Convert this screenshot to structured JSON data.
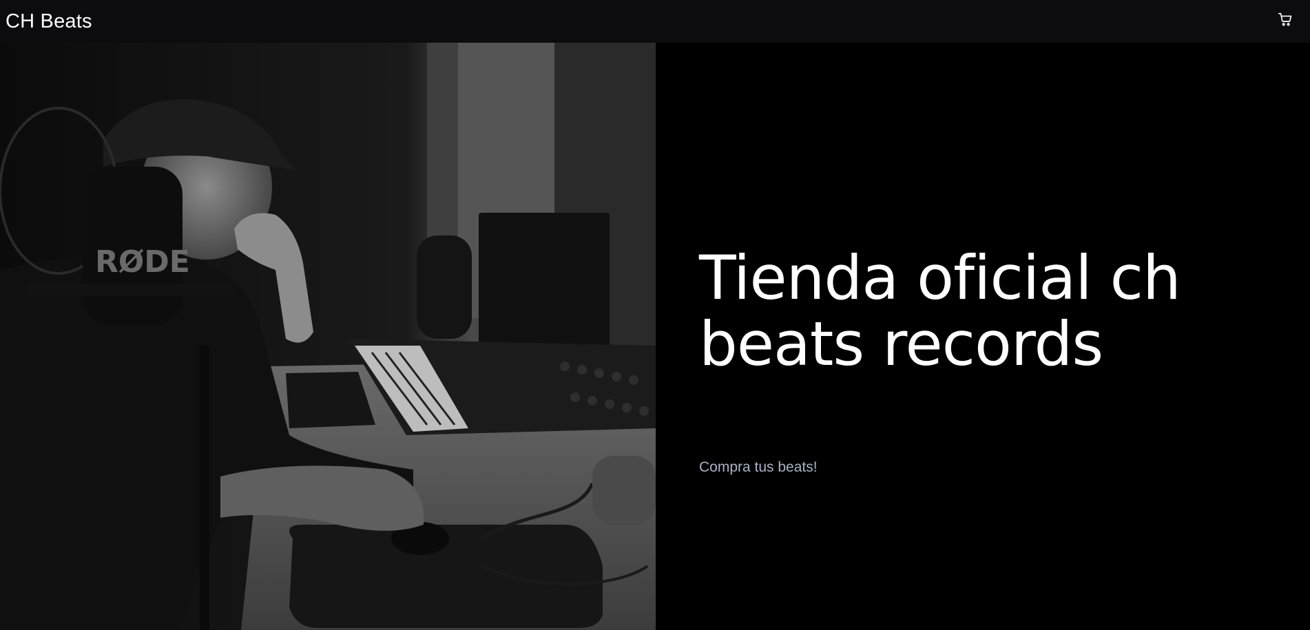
{
  "navbar": {
    "brand": "CH Beats",
    "cart_icon": "cart-icon"
  },
  "hero": {
    "image_alt": "producer-in-studio-photo",
    "title": "Tienda oficial ch beats records",
    "subtitle": "Compra tus beats!"
  },
  "colors": {
    "navbar_bg": "#0c0c0e",
    "page_bg": "#000000",
    "title_text": "#ffffff",
    "subtitle_text": "#a9b3c6"
  }
}
